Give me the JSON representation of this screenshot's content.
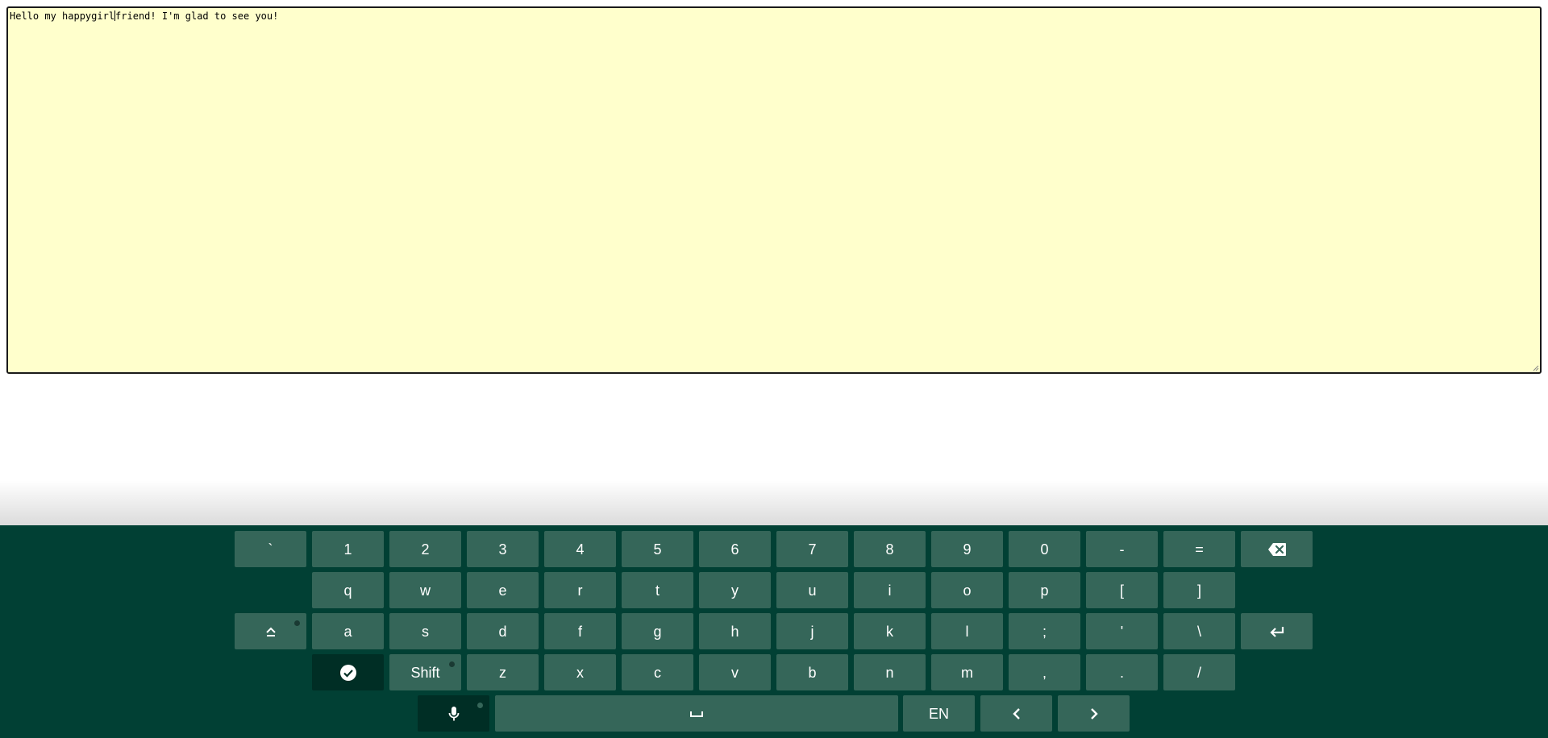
{
  "editor": {
    "text_before_caret": "Hello my happygirl",
    "text_after_caret": "friend! I'm glad to see you!",
    "background_color": "#ffffcc"
  },
  "keyboard": {
    "background_color": "#014034",
    "key_color": "#356659",
    "special_key_color": "#002e25",
    "rows": {
      "numbers": [
        "`",
        "1",
        "2",
        "3",
        "4",
        "5",
        "6",
        "7",
        "8",
        "9",
        "0",
        "-",
        "="
      ],
      "top": [
        "q",
        "w",
        "e",
        "r",
        "t",
        "y",
        "u",
        "i",
        "o",
        "p",
        "[",
        "]"
      ],
      "home": [
        "a",
        "s",
        "d",
        "f",
        "g",
        "h",
        "j",
        "k",
        "l",
        ";",
        "'",
        "\\"
      ],
      "bottom": [
        "z",
        "x",
        "c",
        "v",
        "b",
        "n",
        "m",
        ",",
        ".",
        "/"
      ]
    },
    "shift_label": "Shift",
    "language_label": "EN",
    "icons": {
      "backspace": "backspace-icon",
      "caps": "caps-lock-icon",
      "enter": "enter-icon",
      "done": "checkmark-circle-icon",
      "mic": "microphone-icon",
      "space": "space-bar-icon",
      "left": "chevron-left-icon",
      "right": "chevron-right-icon"
    }
  }
}
